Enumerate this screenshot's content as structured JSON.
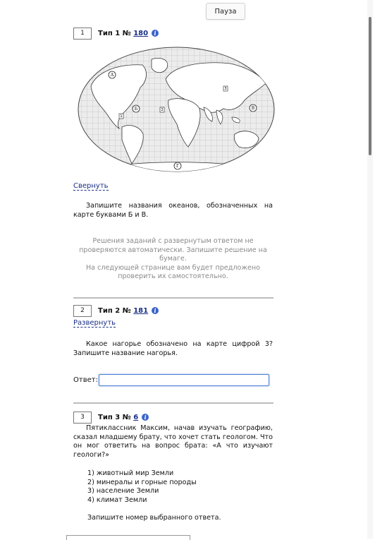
{
  "toolbar": {
    "pause_label": "Пауза"
  },
  "tasks": [
    {
      "number": "1",
      "type_prefix": "Тип 1 №",
      "id": "180",
      "toggle": "Свернуть",
      "question": "Запишите названия океанов, обозначенных на карте буквами Б и В.",
      "notice": [
        "Решения заданий с развернутым ответом не проверяются автоматически. Запишите решение на бумаге.",
        "На следующей странице вам будет предложено проверить их самостоятельно."
      ],
      "map_letters": [
        "А",
        "Б",
        "В",
        "Г"
      ],
      "map_numbers": [
        "1",
        "2",
        "3"
      ]
    },
    {
      "number": "2",
      "type_prefix": "Тип 2 №",
      "id": "181",
      "toggle": "Развернуть",
      "question": "Какое нагорье обозначено на карте цифрой 3? Запишите название нагорья.",
      "answer_label": "Ответ:",
      "answer_value": ""
    },
    {
      "number": "3",
      "type_prefix": "Тип 3 №",
      "id": "6",
      "question": "Пятиклассник Максим, начав изучать географию, сказал младшему брату, что хочет стать геологом. Что он мог ответить на вопрос брата: «А что изучают геологи?»",
      "options": [
        "1) животный мир Земли",
        "2) минералы и горные породы",
        "3) население Земли",
        "4) климат Земли"
      ],
      "instruction": "Запишите номер выбранного ответа."
    }
  ],
  "colors": {
    "link": "#1a2e86",
    "info": "#3a64c9",
    "input_border": "#4a7fd4"
  }
}
